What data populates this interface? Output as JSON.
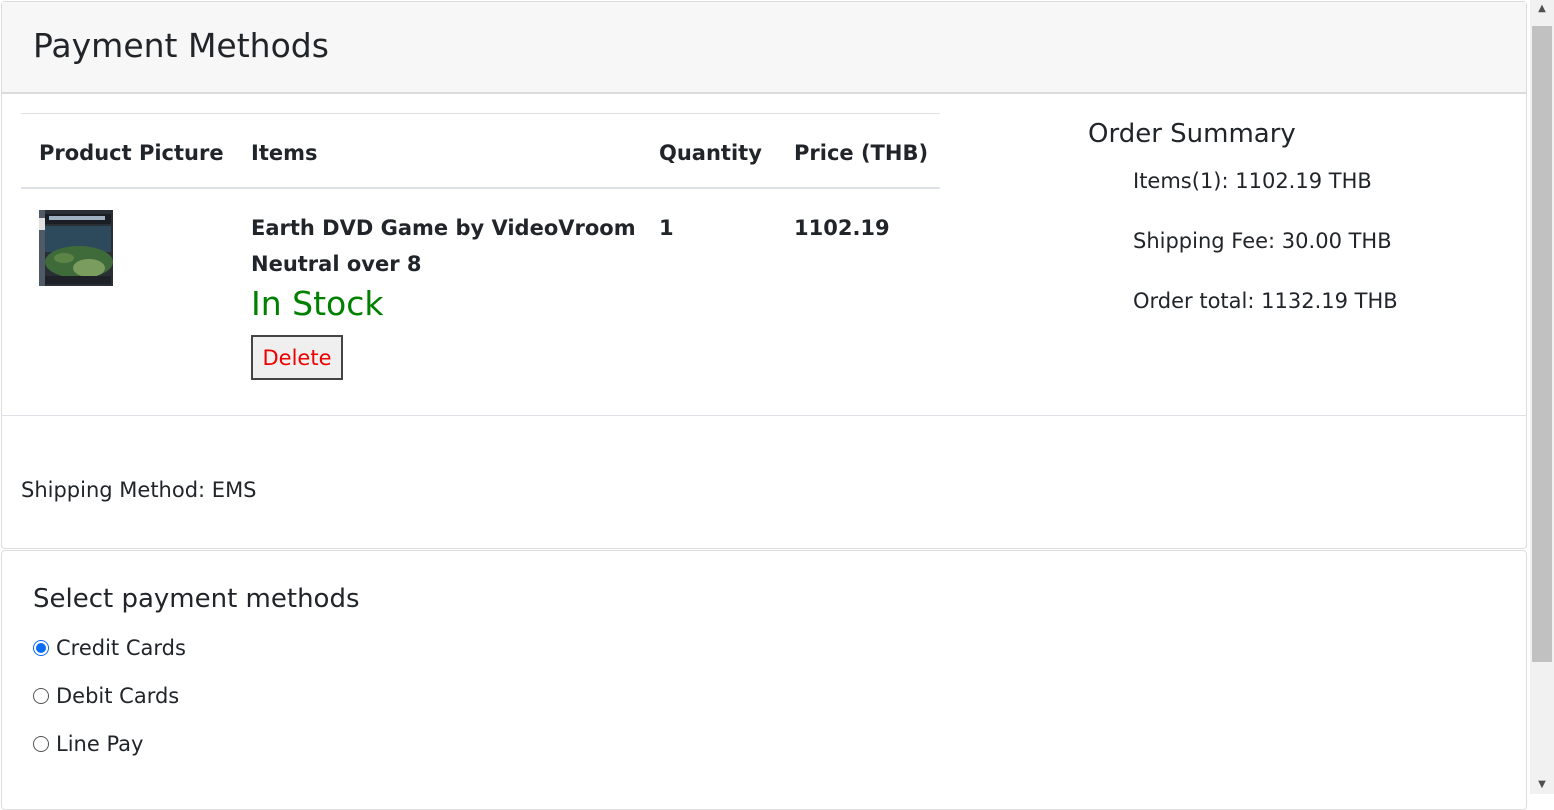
{
  "header": {
    "title": "Payment Methods"
  },
  "cart_table": {
    "columns": [
      "Product Picture",
      "Items",
      "Quantity",
      "Price (THB)"
    ],
    "rows": [
      {
        "item_name": "Earth DVD Game by VideoVroom Neutral over 8",
        "stock_status": "In Stock",
        "delete_label": "Delete",
        "quantity": "1",
        "price": "1102.19"
      }
    ]
  },
  "order_summary": {
    "title": "Order Summary",
    "items_line": "Items(1): 1102.19 THB",
    "shipping_fee_line": "Shipping Fee: 30.00 THB",
    "order_total_line": "Order total: 1132.19 THB"
  },
  "shipping": {
    "method_text": "Shipping Method: EMS"
  },
  "payment": {
    "title": "Select payment methods",
    "options": [
      {
        "label": "Credit Cards",
        "checked": true
      },
      {
        "label": "Debit Cards",
        "checked": false
      },
      {
        "label": "Line Pay",
        "checked": false
      }
    ]
  },
  "colors": {
    "in_stock": "#008000",
    "delete_text": "#ee0000",
    "radio_accent": "#0b6cf6"
  },
  "icons": [
    "dvd-box-thumbnail",
    "scroll-up-arrow-icon",
    "scroll-down-arrow-icon"
  ]
}
